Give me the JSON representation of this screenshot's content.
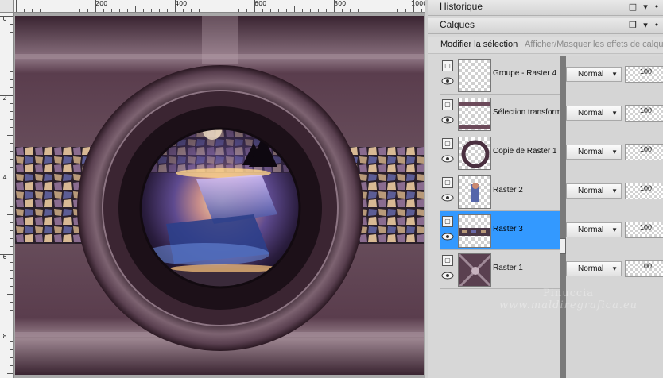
{
  "canvas": {
    "ruler_h_labels": [
      "200",
      "400",
      "600",
      "800",
      "1000"
    ],
    "ruler_v_labels": [
      "0",
      "2",
      "4",
      "6",
      "8"
    ]
  },
  "panels": {
    "history": {
      "title": "Historique"
    },
    "layers": {
      "title": "Calques",
      "modify_selection_label": "Modifier la sélection",
      "toggle_effects_label": "Afficher/Masquer les effets de calque"
    }
  },
  "layers": [
    {
      "name": "Groupe - Raster 4",
      "blend": "Normal",
      "opacity": "100",
      "selected": false
    },
    {
      "name": "Sélection transformée",
      "blend": "Normal",
      "opacity": "100",
      "selected": false
    },
    {
      "name": "Copie de Raster 1",
      "blend": "Normal",
      "opacity": "100",
      "selected": false
    },
    {
      "name": "Raster 2",
      "blend": "Normal",
      "opacity": "100",
      "selected": false
    },
    {
      "name": "Raster 3",
      "blend": "Normal",
      "opacity": "100",
      "selected": true
    },
    {
      "name": "Raster 1",
      "blend": "Normal",
      "opacity": "100",
      "selected": false
    }
  ],
  "watermark": {
    "line1": "Pinuccia",
    "line2": "www.maldiregrafica.eu"
  },
  "colors": {
    "selection": "#3399ff",
    "canvas_bg": "#4a3140"
  },
  "icons": {
    "history_maximize": "maximize-icon",
    "history_menu": "menu-arrow-icon",
    "history_pin": "pin-icon",
    "layers_restore": "restore-icon",
    "layers_pin": "pin-icon"
  }
}
